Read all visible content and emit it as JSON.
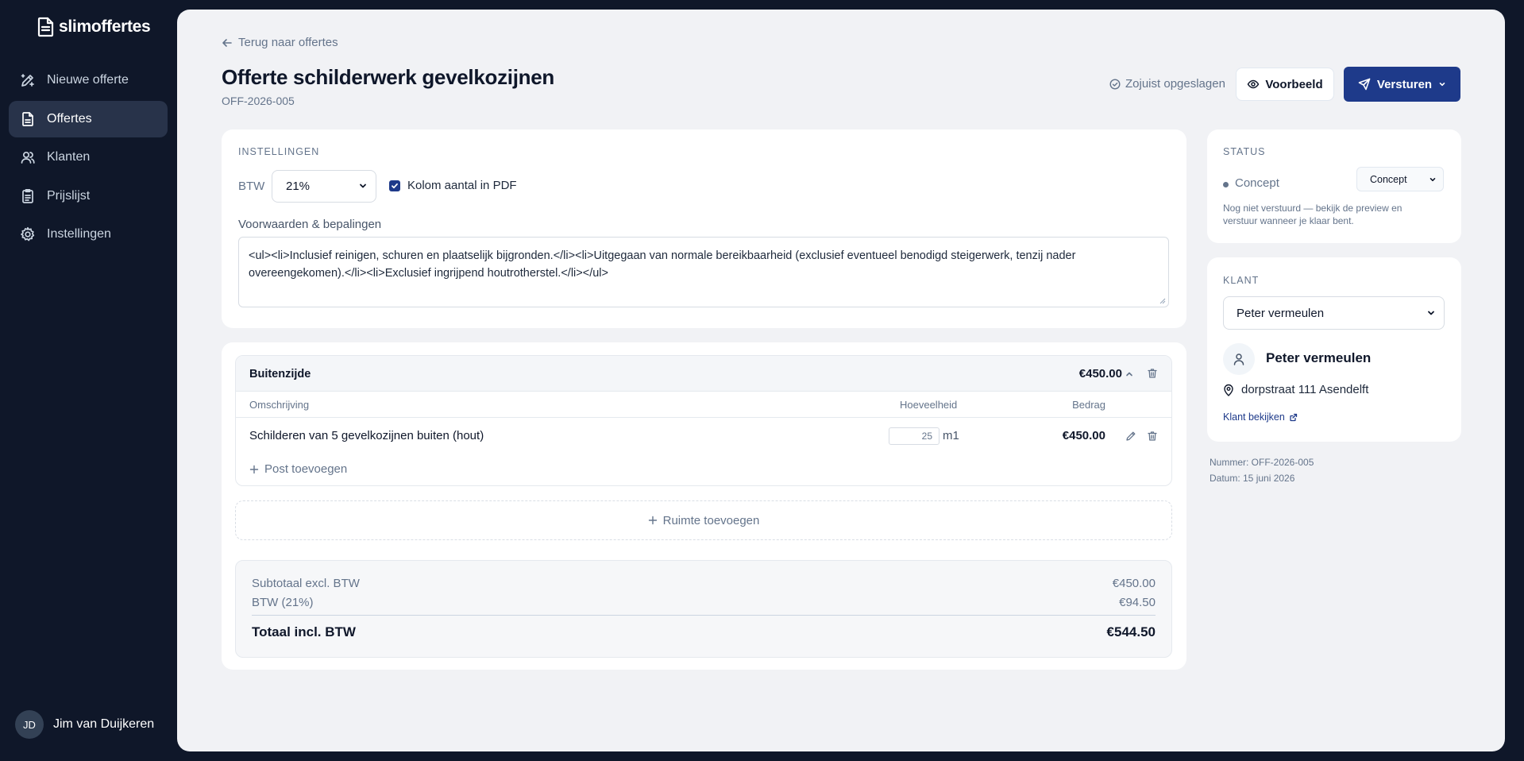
{
  "brand": {
    "name": "slimoffertes"
  },
  "sidebar": {
    "items": [
      {
        "label": "Nieuwe offerte",
        "icon": "pencil-sparkle-icon",
        "active": false
      },
      {
        "label": "Offertes",
        "icon": "document-icon",
        "active": true
      },
      {
        "label": "Klanten",
        "icon": "users-icon",
        "active": false
      },
      {
        "label": "Prijslijst",
        "icon": "clipboard-icon",
        "active": false
      },
      {
        "label": "Instellingen",
        "icon": "gear-icon",
        "active": false
      }
    ],
    "user": {
      "initials": "JD",
      "name": "Jim van Duijkeren"
    }
  },
  "header": {
    "back_label": "Terug naar offertes",
    "title": "Offerte schilderwerk gevelkozijnen",
    "number": "OFF-2026-005",
    "saved_label": "Zojuist opgeslagen",
    "preview_label": "Voorbeeld",
    "send_label": "Versturen"
  },
  "settings": {
    "section_label": "Instellingen",
    "btw_label": "BTW",
    "btw_value": "21%",
    "kolom_label": "Kolom aantal in PDF",
    "kolom_checked": true,
    "terms_label": "Voorwaarden & bepalingen",
    "terms_value": "<ul><li>Inclusief reinigen, schuren en plaatselijk bijgronden.</li><li>Uitgegaan van normale bereikbaarheid (exclusief eventueel benodigd steigerwerk, tenzij nader overeengekomen).</li><li>Exclusief ingrijpend houtrotherstel.</li></ul>"
  },
  "room": {
    "name": "Buitenzijde",
    "total": "€450.00",
    "columns": {
      "description": "Omschrijving",
      "quantity": "Hoeveelheid",
      "amount": "Bedrag"
    },
    "rows": [
      {
        "description": "Schilderen van 5 gevelkozijnen buiten (hout)",
        "quantity": "25",
        "unit": "m1",
        "amount": "€450.00"
      }
    ],
    "add_post_label": "Post toevoegen"
  },
  "add_room_label": "Ruimte toevoegen",
  "totals": {
    "subtotal_label": "Subtotaal excl. BTW",
    "subtotal_value": "€450.00",
    "btw_label": "BTW (21%)",
    "btw_value": "€94.50",
    "total_label": "Totaal incl. BTW",
    "total_value": "€544.50"
  },
  "status": {
    "section_label": "Status",
    "value": "Concept",
    "select_value": "Concept",
    "note": "Nog niet verstuurd — bekijk de preview en verstuur wanneer je klaar bent."
  },
  "klant": {
    "section_label": "Klant",
    "select_value": "Peter vermeulen",
    "name": "Peter vermeulen",
    "address": "dorpstraat 111 Asendelft",
    "link_label": "Klant bekijken"
  },
  "meta": {
    "number_line": "Nummer: OFF-2026-005",
    "date_line": "Datum: 15 juni 2026"
  },
  "colors": {
    "sidebar_bg": "#0f1729",
    "primary": "#1e3a8a",
    "main_bg": "#f1f2f5"
  }
}
